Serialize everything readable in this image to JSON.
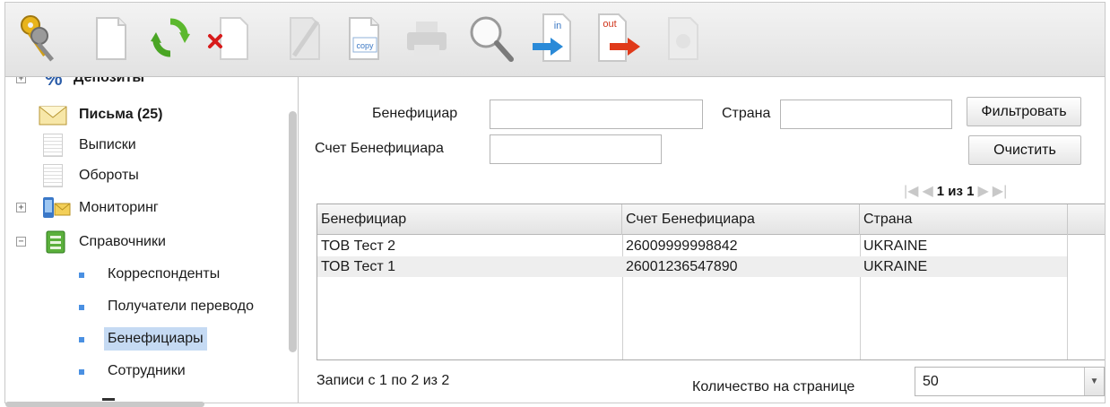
{
  "sidebar": {
    "items": [
      {
        "label": "Депозиты"
      },
      {
        "label": "Письма (25)"
      },
      {
        "label": "Выписки"
      },
      {
        "label": "Обороты"
      },
      {
        "label": "Мониторинг"
      },
      {
        "label": "Справочники"
      },
      {
        "label": "Корреспонденты"
      },
      {
        "label": "Получатели переводо"
      },
      {
        "label": "Бенефициары"
      },
      {
        "label": "Сотрудники"
      }
    ]
  },
  "toolbar": {
    "copy_text": "copy",
    "in_text": "in",
    "out_text": "out"
  },
  "filter": {
    "beneficiary_label": "Бенефициар",
    "beneficiary_value": "",
    "country_label": "Страна",
    "country_value": "",
    "account_label": "Счет Бенефициара",
    "account_value": "",
    "filter_button": "Фильтровать",
    "clear_button": "Очистить"
  },
  "pager": {
    "text": "1 из 1"
  },
  "grid": {
    "columns": [
      "Бенефициар",
      "Счет Бенефициара",
      "Страна"
    ],
    "rows": [
      [
        "ТОВ Тест 2",
        "26009999998842",
        "UKRAINE"
      ],
      [
        "ТОВ Тест 1",
        "26001236547890",
        "UKRAINE"
      ]
    ]
  },
  "footer": {
    "records_text": "Записи с 1 по 2 из 2",
    "per_page_label": "Количество на странице",
    "per_page_value": "50"
  },
  "colors": {
    "selected_bg": "#c5daf3",
    "row_alt": "#eeeeee",
    "bullet": "#4a90e2"
  }
}
